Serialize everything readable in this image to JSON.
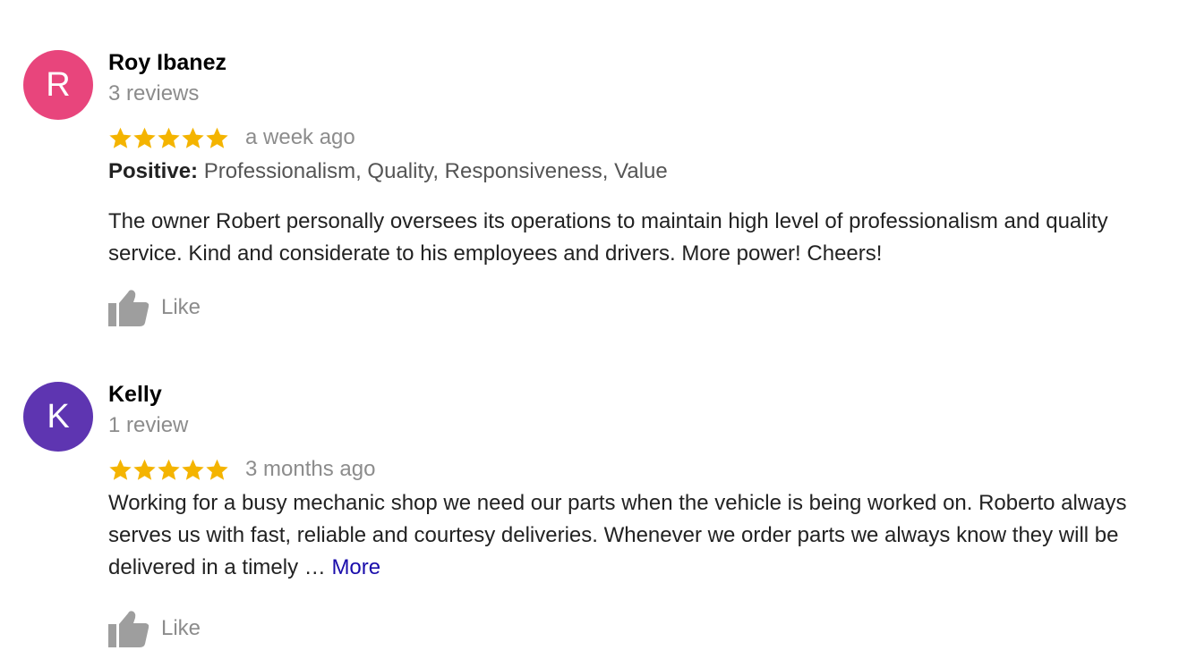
{
  "reviews": [
    {
      "initial": "R",
      "avatar_color": "#e8457c",
      "name": "Roy Ibanez",
      "review_count": "3 reviews",
      "stars": 5,
      "date": "a week ago",
      "positive_label": "Positive:",
      "positive_items": "Professionalism, Quality, Responsiveness, Value",
      "text": "The owner Robert personally oversees its operations to maintain high level of professionalism and quality service.  Kind and considerate to his employees and drivers. More power! Cheers!",
      "like_label": "Like"
    },
    {
      "initial": "K",
      "avatar_color": "#5e35b1",
      "name": "Kelly",
      "review_count": "1 review",
      "stars": 5,
      "date": "3 months ago",
      "text": "Working for a busy mechanic shop we need our parts when the vehicle is being worked on.  Roberto always serves us with fast, reliable and courtesy deliveries.  Whenever we order parts we always know they will be delivered in a timely … ",
      "more_label": "More",
      "like_label": "Like"
    }
  ],
  "colors": {
    "star": "#f4b400",
    "like_icon": "#9e9e9e",
    "more_link": "#1a0dab"
  },
  "icons": {
    "star": "star-icon",
    "like": "thumbs-up-icon"
  }
}
